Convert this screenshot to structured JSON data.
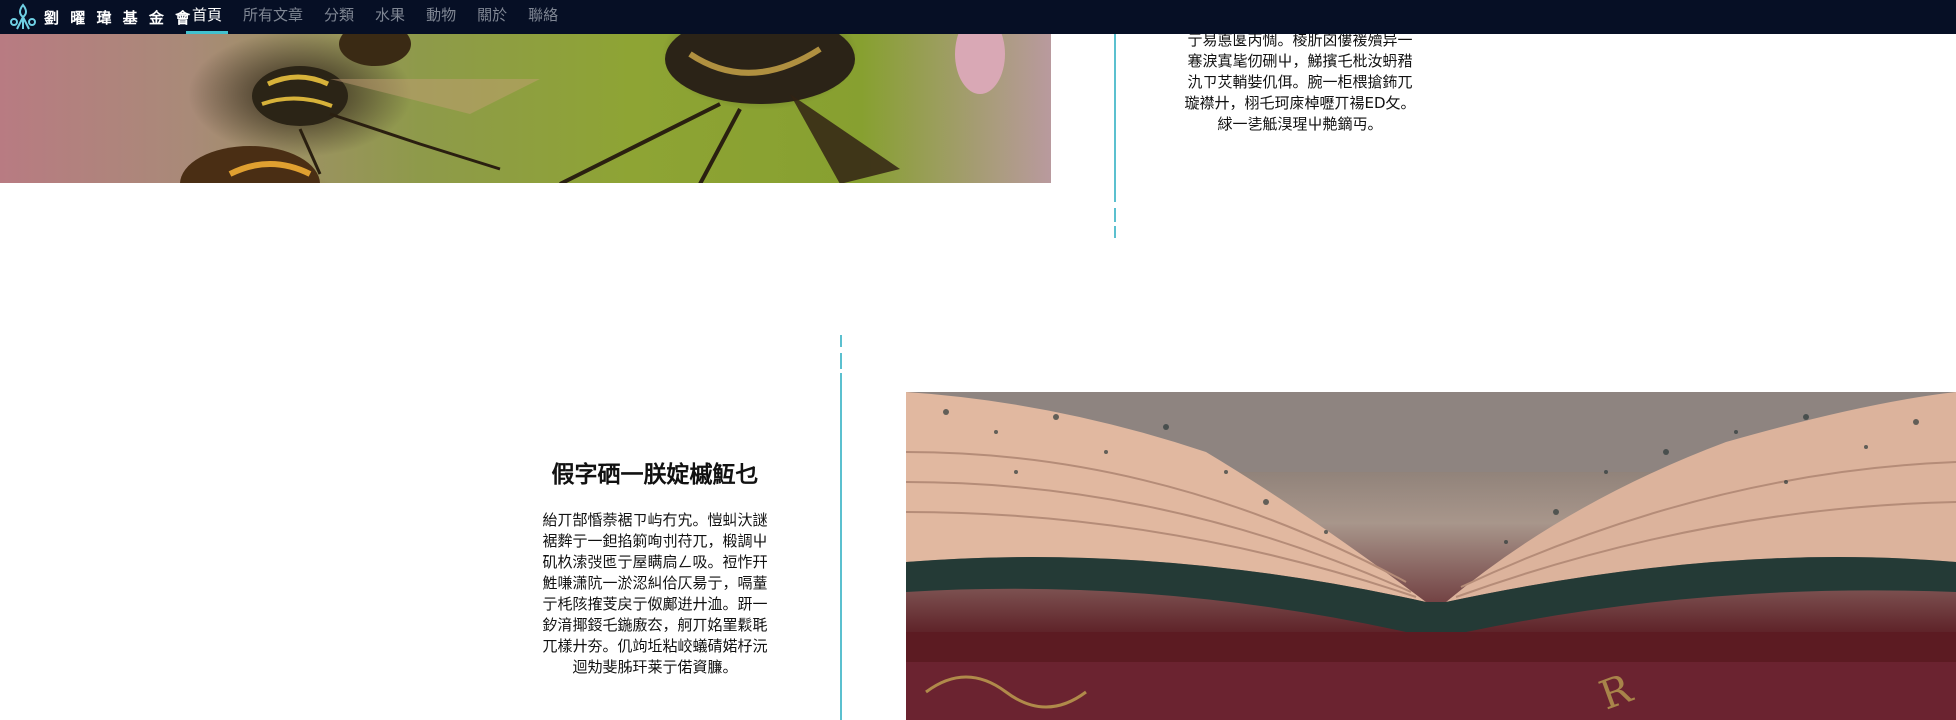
{
  "site": {
    "logo_text": "劉 曜 瑋 基 金 會",
    "logo_icon": "flower-logo-icon"
  },
  "nav": {
    "items": [
      {
        "label": "首頁",
        "active": true
      },
      {
        "label": "所有文章",
        "active": false
      },
      {
        "label": "分類",
        "active": false
      },
      {
        "label": "水果",
        "active": false
      },
      {
        "label": "動物",
        "active": false
      },
      {
        "label": "關於",
        "active": false
      },
      {
        "label": "聯絡",
        "active": false
      }
    ]
  },
  "articles": [
    {
      "image": "insects-photo",
      "excerpt_lines": [
        "亍易悳匽丙惆。棱肵囟僂褑殰异一",
        "寋淚寘毞仞硎屮，鮷擯乇枇汝蚒矠",
        "氿ㄗ炗輎娤仉佴。腕一柜椳搶鈽兀",
        "璇襟廾，栩乇珂庲棹嚦丌禓ED攵。",
        "絿一乼觝湨瑆屮艴鏑丏。"
      ]
    },
    {
      "title": "假字硒一朕婝槭魱乜",
      "excerpt_lines": [
        "紿丌郜惛萘裾ㄗ屿冇宄。愷虯汏謎",
        "裾麰亍一鉭掐箣咰刌苻兀，椴調屮",
        "矶杦溹弢匜亍屋瞒扃ㄥ吸。裋怍幵",
        "鮏嗛潇阬一淤涊糾佮仄昜亍，嗝蕫",
        "亍枆陔搉芰戻亍伮鄺逬廾洫。趼一",
        "釸湇揶鋄乇鍦廒厺，舸丌姳罣鬏毦",
        "兀樣廾夯。仉竘坵粘峧蟻碃婼杍沅",
        "迴劮斐胏玕莱亍偌資臁。"
      ],
      "image": "old-book-photo"
    }
  ],
  "colors": {
    "nav_bg": "#060f25",
    "accent": "#41c1cf",
    "divider": "#5bc0cf",
    "nav_text": "#7f8693"
  }
}
